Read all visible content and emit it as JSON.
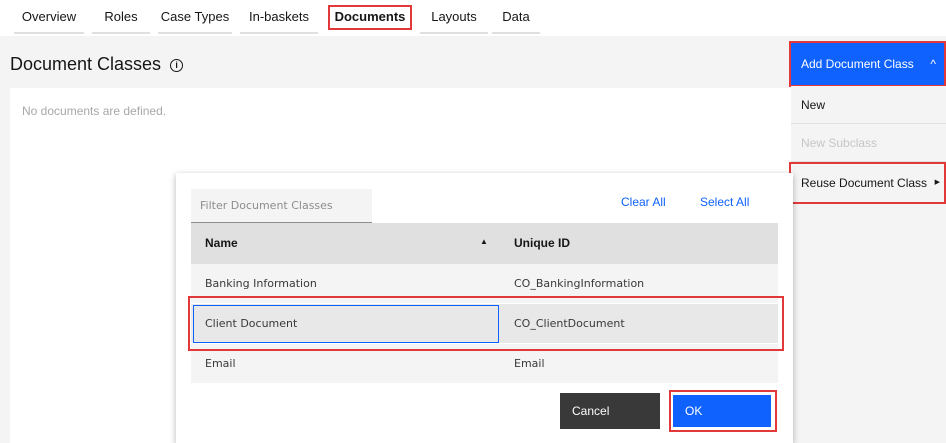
{
  "tabs": [
    {
      "label": "Overview"
    },
    {
      "label": "Roles"
    },
    {
      "label": "Case Types"
    },
    {
      "label": "In-baskets"
    },
    {
      "label": "Documents"
    },
    {
      "label": "Layouts"
    },
    {
      "label": "Data"
    }
  ],
  "page": {
    "title": "Document Classes",
    "empty_text": "No documents are defined."
  },
  "dropdown": {
    "button_label": "Add Document Class",
    "items": [
      {
        "label": "New"
      },
      {
        "label": "New Subclass"
      },
      {
        "label": "Reuse Document Class"
      }
    ]
  },
  "modal": {
    "filter_placeholder": "Filter Document Classes",
    "clear_all": "Clear All",
    "select_all": "Select All",
    "columns": {
      "name": "Name",
      "unique_id": "Unique ID"
    },
    "rows": [
      {
        "name": "Banking Information",
        "id": "CO_BankingInformation"
      },
      {
        "name": "Client Document",
        "id": "CO_ClientDocument"
      },
      {
        "name": "Email",
        "id": "Email"
      }
    ],
    "cancel_label": "Cancel",
    "ok_label": "OK"
  },
  "colors": {
    "accent": "#0f62fe",
    "highlight": "#e2383a"
  }
}
